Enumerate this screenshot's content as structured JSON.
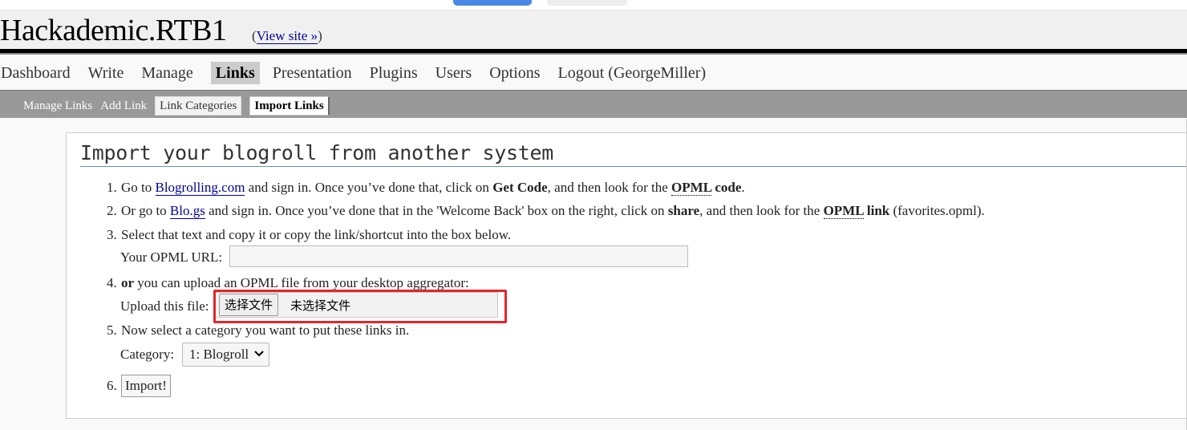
{
  "header": {
    "site_title": "Hackademic.RTB1",
    "view_site_prefix": "(",
    "view_site_link": "View site »",
    "view_site_suffix": ")"
  },
  "mainnav": {
    "items": [
      {
        "label": "Dashboard"
      },
      {
        "label": "Write"
      },
      {
        "label": "Manage"
      },
      {
        "label": "Links",
        "current": true
      },
      {
        "label": "Presentation"
      },
      {
        "label": "Plugins"
      },
      {
        "label": "Users"
      },
      {
        "label": "Options"
      },
      {
        "label": "Logout (GeorgeMiller)"
      }
    ]
  },
  "subnav": {
    "items": [
      {
        "label": "Manage Links"
      },
      {
        "label": "Add Link"
      },
      {
        "label": "Link Categories"
      },
      {
        "label": "Import Links",
        "selected": true
      }
    ]
  },
  "main": {
    "heading": "Import your blogroll from another system",
    "step1": {
      "num": "1.",
      "t1": "Go to ",
      "link": "Blogrolling.com",
      "t2": " and sign in. Once you’ve done that, click on ",
      "b1": "Get Code",
      "t3": ", and then look for the ",
      "abbr": "OPML",
      "b2": " code",
      "t4": "."
    },
    "step2": {
      "num": "2.",
      "t1": "Or go to ",
      "link": "Blo.gs",
      "t2": " and sign in. Once you’ve done that in the 'Welcome Back' box on the right, click on ",
      "b1": "share",
      "t3": ", and then look for the ",
      "abbr": "OPML",
      "b2": " link",
      "t4": " (favorites.opml)."
    },
    "step3": {
      "num": "3.",
      "text": "Select that text and copy it or copy the link/shortcut into the box below.",
      "url_label": "Your OPML URL:",
      "url_value": ""
    },
    "step4": {
      "num": "4.",
      "b1": "or",
      "text": " you can upload an OPML file from your desktop aggregator:",
      "file_label": "Upload this file:",
      "file_button": "选择文件",
      "file_status": "未选择文件"
    },
    "step5": {
      "num": "5.",
      "text": "Now select a category you want to put these links in.",
      "category_label": "Category:",
      "category_selected": "1: Blogroll"
    },
    "step6": {
      "num": "6.",
      "import_button": "Import!"
    }
  },
  "colors": {
    "link": "#00019b",
    "subnav_bg": "#999999",
    "highlight": "#e3262a",
    "heading_rule": "#6b8fb3"
  }
}
